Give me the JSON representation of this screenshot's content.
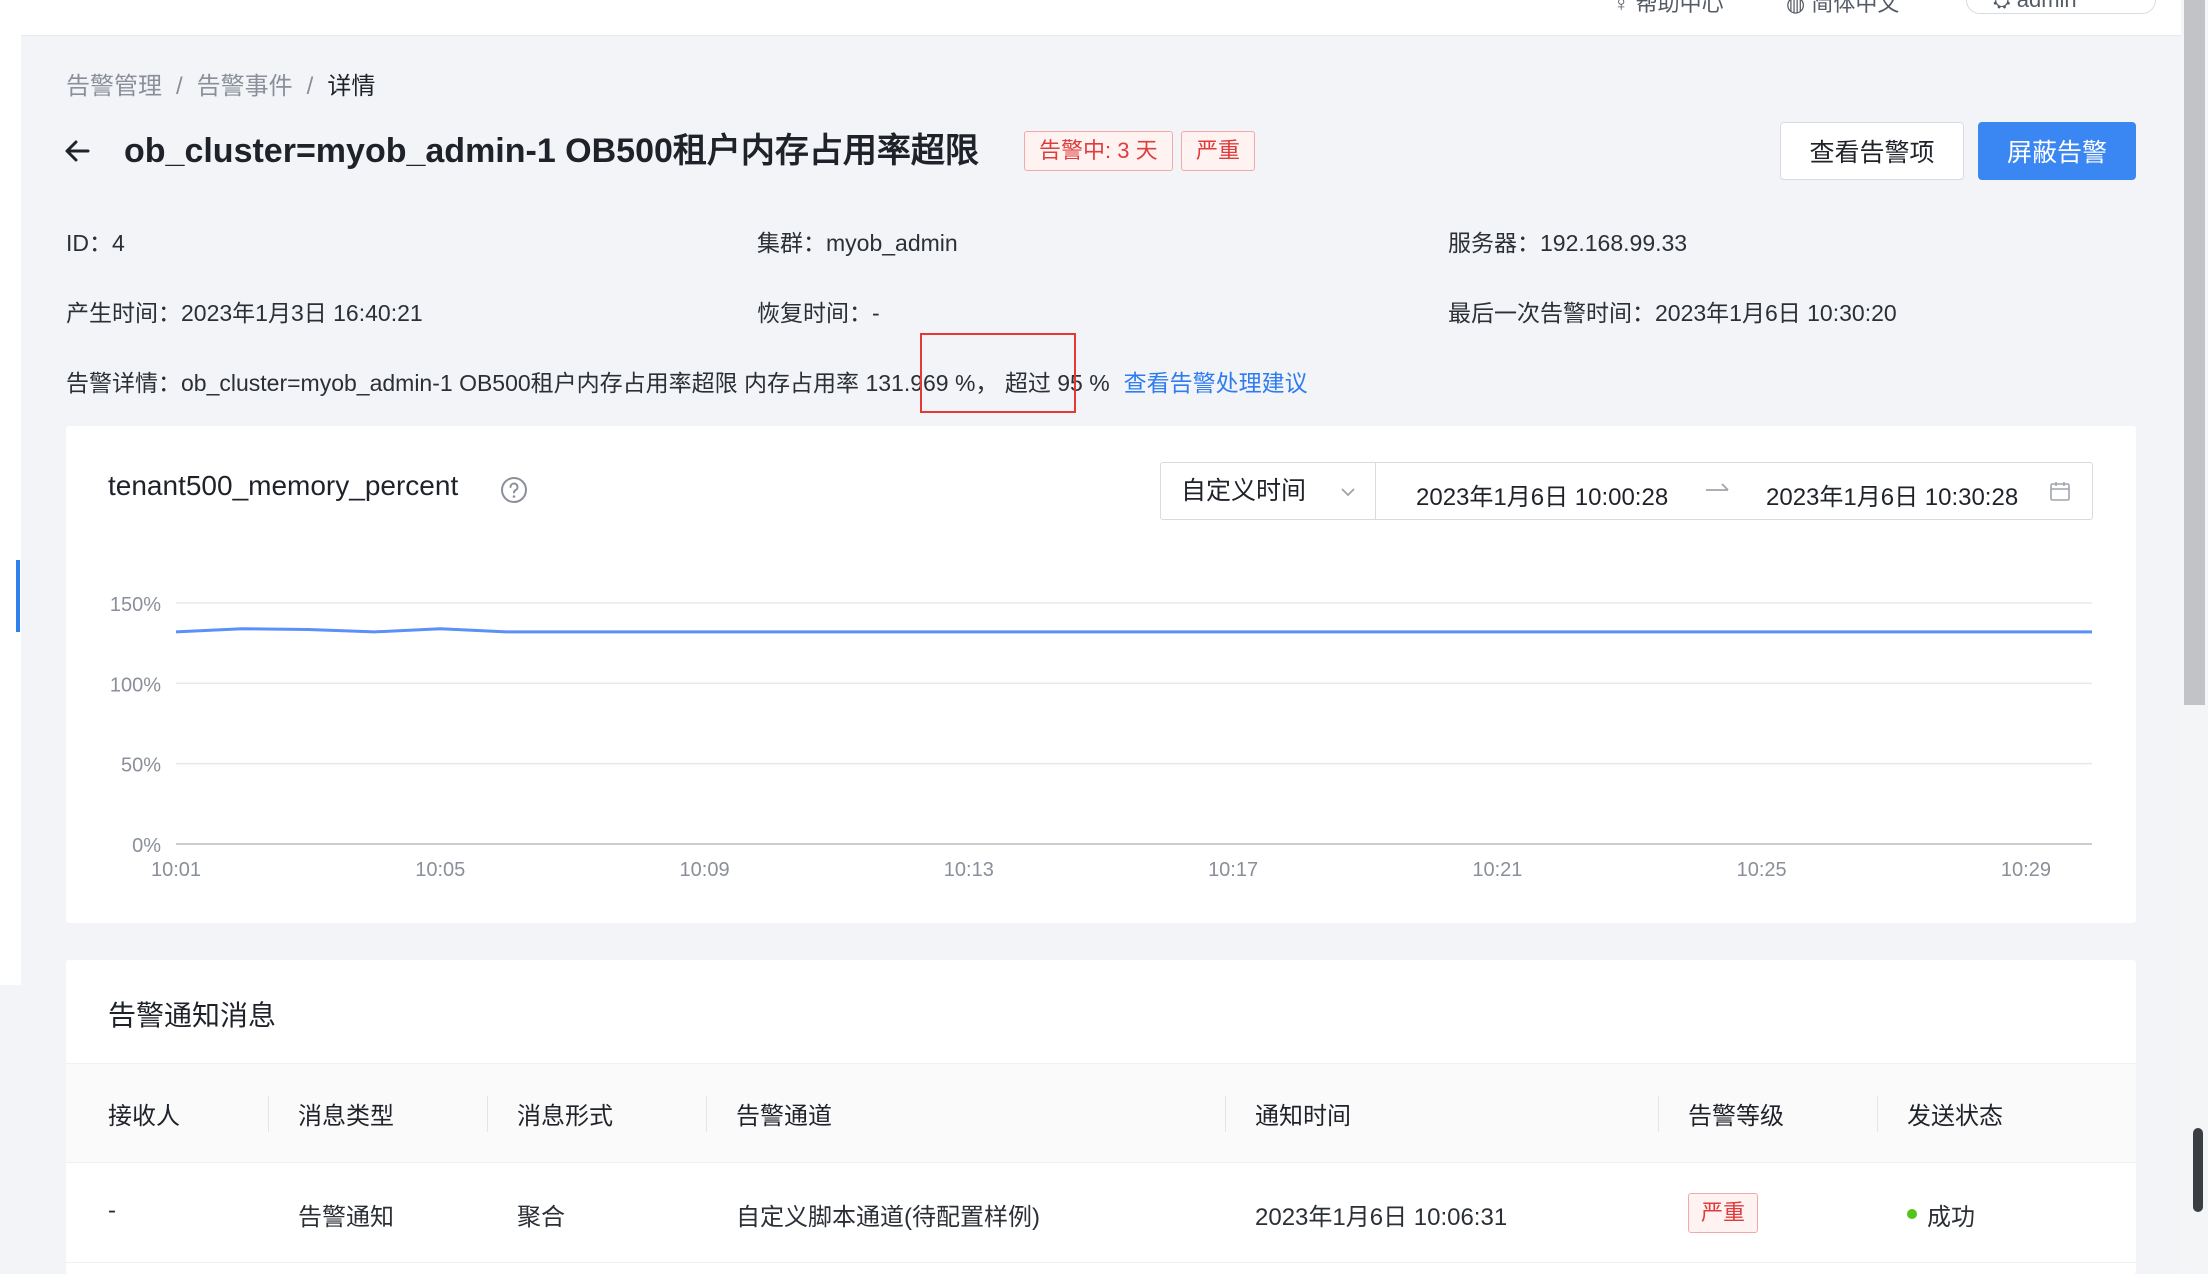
{
  "topbar": {
    "help_label": "帮助中心",
    "lang_label": "简体中文",
    "user_label": "admin"
  },
  "breadcrumb": {
    "items": [
      "告警管理",
      "告警事件"
    ],
    "current": "详情",
    "separator": "/"
  },
  "header": {
    "title": "ob_cluster=myob_admin-1 OB500租户内存占用率超限",
    "status_tag": "告警中: 3 天",
    "level_tag": "严重",
    "view_items_button": "查看告警项",
    "mute_button": "屏蔽告警"
  },
  "info": {
    "id_label": "ID：",
    "id_value": "4",
    "cluster_label": "集群：",
    "cluster_value": "myob_admin",
    "server_label": "服务器：",
    "server_value": "192.168.99.33",
    "created_label": "产生时间：",
    "created_value": "2023年1月3日 16:40:21",
    "recovered_label": "恢复时间：",
    "recovered_value": "-",
    "last_alert_label": "最后一次告警时间：",
    "last_alert_value": "2023年1月6日 10:30:20"
  },
  "detail": {
    "label": "告警详情：",
    "text_before": "ob_cluster=myob_admin-1 OB500租户内存占用率超限 内存占用率",
    "value": " 131.969 %，",
    "text_after": " 超过 95 %",
    "advice_link": "查看告警处理建议"
  },
  "chart_panel": {
    "title": "tenant500_memory_percent",
    "time_mode": "自定义时间",
    "start_time": "2023年1月6日 10:00:28",
    "end_time": "2023年1月6日 10:30:28"
  },
  "chart_data": {
    "type": "line",
    "title": "tenant500_memory_percent",
    "xlabel": "",
    "ylabel": "",
    "x_ticks": [
      "10:01",
      "10:05",
      "10:09",
      "10:13",
      "10:17",
      "10:21",
      "10:25",
      "10:29"
    ],
    "y_ticks": [
      "150%",
      "100%",
      "50%",
      "0%"
    ],
    "ylim": [
      0,
      150
    ],
    "grid": true,
    "series": [
      {
        "color": "#5b8ff9",
        "x": [
          "10:01",
          "10:02",
          "10:03",
          "10:04",
          "10:05",
          "10:06",
          "10:07",
          "10:08",
          "10:09",
          "10:10",
          "10:11",
          "10:12",
          "10:13",
          "10:14",
          "10:15",
          "10:16",
          "10:17",
          "10:18",
          "10:19",
          "10:20",
          "10:21",
          "10:22",
          "10:23",
          "10:24",
          "10:25",
          "10:26",
          "10:27",
          "10:28",
          "10:29",
          "10:30"
        ],
        "values": [
          132,
          134,
          133.5,
          132,
          134,
          132,
          132,
          132,
          132,
          132,
          132,
          132,
          132,
          132,
          132,
          132,
          132,
          132,
          132,
          132,
          132,
          132,
          132,
          132,
          132,
          132,
          132,
          132,
          132,
          132
        ]
      }
    ]
  },
  "notifications": {
    "title": "告警通知消息",
    "columns": [
      "接收人",
      "消息类型",
      "消息形式",
      "告警通道",
      "通知时间",
      "告警等级",
      "发送状态"
    ],
    "rows": [
      {
        "receiver": "-",
        "msg_type": "告警通知",
        "msg_form": "聚合",
        "channel": "自定义脚本通道(待配置样例)",
        "time": "2023年1月6日 10:06:31",
        "level": "严重",
        "status": "成功"
      }
    ]
  },
  "colors": {
    "primary": "#3a86f2",
    "danger": "#e03c3c",
    "line": "#5b8ff9",
    "success": "#52c41a"
  }
}
